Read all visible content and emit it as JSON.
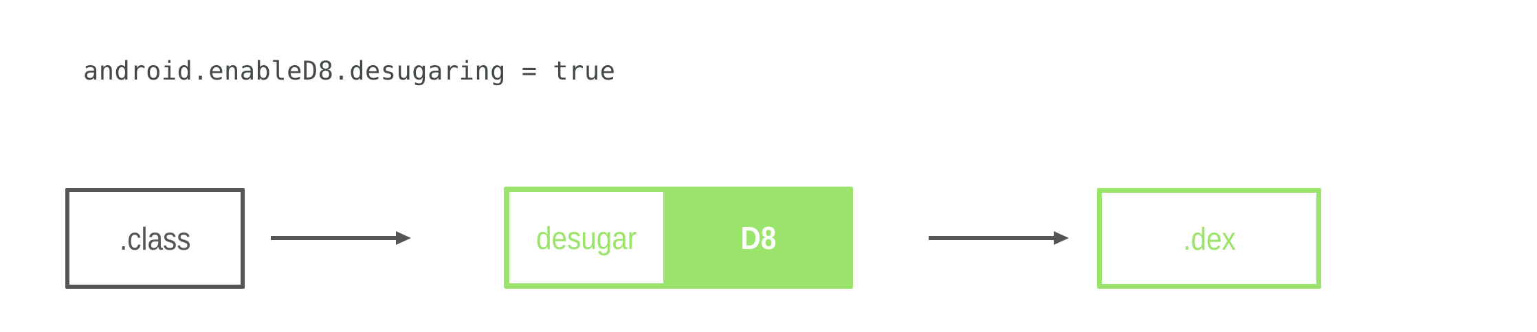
{
  "code": {
    "text": "android.enableD8.desugaring = true"
  },
  "diagram": {
    "input_box_label": ".class",
    "desugar_label": "desugar",
    "d8_label": "D8",
    "output_box_label": ".dex"
  },
  "colors": {
    "green": "#9be46b",
    "gray": "#555555",
    "code_text": "#44494b"
  }
}
